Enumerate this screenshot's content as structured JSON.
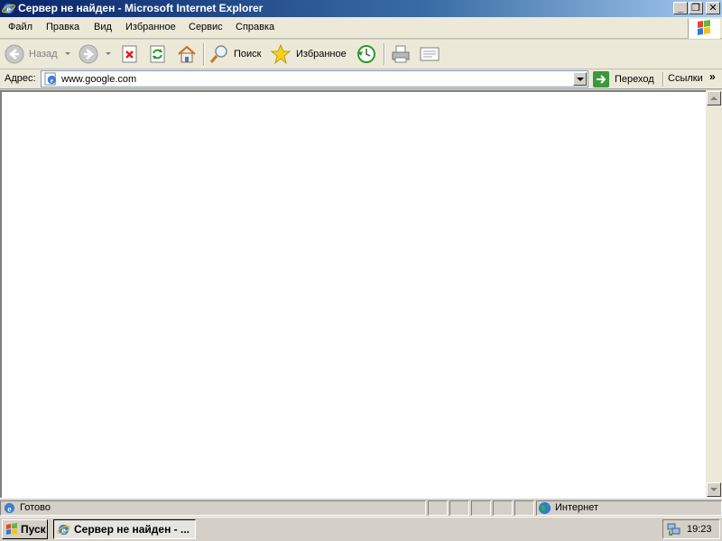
{
  "window": {
    "title": "Сервер не найден - Microsoft Internet Explorer",
    "min_glyph": "_",
    "max_glyph": "❐",
    "close_glyph": "✕"
  },
  "menu": {
    "items": [
      "Файл",
      "Правка",
      "Вид",
      "Избранное",
      "Сервис",
      "Справка"
    ]
  },
  "toolbar": {
    "back_label": "Назад",
    "search_label": "Поиск",
    "favorites_label": "Избранное"
  },
  "address": {
    "label": "Адрес:",
    "url": "www.google.com",
    "go_label": "Переход",
    "links_label": "Ссылки",
    "links_chevron": "»"
  },
  "status": {
    "text": "Готово",
    "zone": "Интернет"
  },
  "taskbar": {
    "start_label": "Пуск",
    "task_label": "Сервер не найден - ...",
    "clock": "19:23"
  },
  "colors": {
    "titlebar_start": "#0a246a",
    "titlebar_end": "#a6caf0",
    "chrome": "#ece9d8",
    "classic_gray": "#d4d0c8",
    "go_green": "#3a9a3a"
  }
}
